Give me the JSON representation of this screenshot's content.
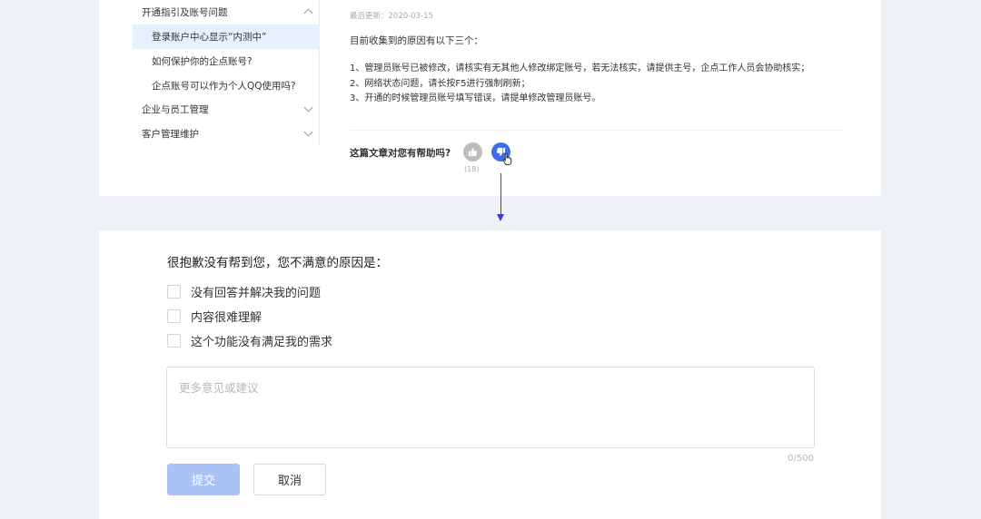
{
  "sidebar": {
    "items": [
      {
        "label": "开通指引及账号问题",
        "expanded": true
      },
      {
        "label": "登录账户中心显示“内测中”",
        "active": true
      },
      {
        "label": "如何保护你的企点账号?"
      },
      {
        "label": "企点账号可以作为个人QQ使用吗?"
      },
      {
        "label": "企业与员工管理",
        "expanded": false
      },
      {
        "label": "客户管理维护",
        "expanded": false
      }
    ]
  },
  "article": {
    "updated": "最后更新：2020-03-15",
    "intro": "目前收集到的原因有以下三个：",
    "reasons": [
      "1、管理员账号已被修改，请核实有无其他人修改绑定账号，若无法核实，请提供主号，企点工作人员会协助核实；",
      "2、网络状态问题，请长按F5进行强制刷新；",
      "3、开通的时候管理员账号填写错误，请提单修改管理员账号。"
    ],
    "helpful_question": "这篇文章对您有帮助吗?",
    "like_count": "(18)",
    "thumb_up_icon": "thumbs-up-icon",
    "thumb_down_icon": "thumbs-down-icon"
  },
  "feedback": {
    "title": "很抱歉没有帮到您，您不满意的原因是：",
    "options": [
      {
        "label": "没有回答并解决我的问题",
        "checked": false
      },
      {
        "label": "内容很难理解",
        "checked": false
      },
      {
        "label": "这个功能没有满足我的需求",
        "checked": false
      }
    ],
    "placeholder": "更多意见或建议",
    "value": "",
    "counter": "0/500",
    "submit_label": "提交",
    "cancel_label": "取消"
  },
  "colors": {
    "accent": "#3c6fe6",
    "submit_disabled": "#a9c3f7",
    "active_item_bg": "#e7f0fd",
    "arrow": "#3b3bd6",
    "page_bg": "#eef1f6"
  }
}
